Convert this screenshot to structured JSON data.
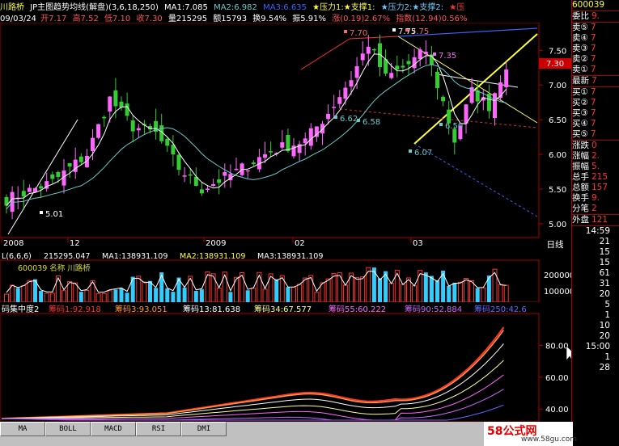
{
  "header": {
    "stock_name": "川路桥",
    "indicator_name": "JP主图趋势均线(解盘)",
    "indicator_params": "(3,6,18,250)",
    "ma1": "MA1:7.085",
    "ma2": "MA2:6.982",
    "ma3": "MA3:6.635",
    "pressure1": "★压力1:",
    "support1": "★支撑1:",
    "pressure2": "★压力2:",
    "support2": "★支撑2:",
    "pressure3": "★压"
  },
  "quote": {
    "date": "09/03/24",
    "open": "开7.17",
    "high": "高7.52",
    "low": "低7.10",
    "close": "收7.30",
    "volume": "量215295",
    "amount": "额15793",
    "turnover": "换9.54%",
    "amplitude": "振5.91%",
    "change": "涨(0.19)2.67%",
    "index": "指数(12.94)0.56%"
  },
  "main_chart": {
    "y_ticks": [
      "7.50",
      "7.00",
      "6.50",
      "6.00",
      "5.50",
      "5.00"
    ],
    "x_ticks": [
      "2008",
      "12",
      "2009",
      "02",
      "03"
    ],
    "price_tag": "7.30",
    "period_label": "日线",
    "annotations": [
      "7.70",
      "7.75",
      "7.75",
      "7.35",
      "6.62",
      "6.58",
      "6.50",
      "6.07",
      "5.01"
    ],
    "colors": {
      "up": "#ff66ff",
      "down": "#33cc33",
      "ma": "#ffffff",
      "ma_long": "#66cccc",
      "resist": "#ff3333",
      "support": "#ffff33",
      "trend": "#3366ff"
    }
  },
  "volume_chart": {
    "header_main": "L(6,6,6)",
    "header_vol": "215295.047",
    "ma1": "MA1:138931.109",
    "ma2": "MA2:138931.109",
    "ma3": "MA3:138931.109",
    "overlay_text": "600039 名称 川路桥",
    "y_ticks": [
      "200000",
      "100000"
    ]
  },
  "indicator_chart": {
    "title": "码集中度2",
    "c1": "筹码1:92.918",
    "c3": "筹码3:93.051",
    "c13": "筹码13:81.638",
    "c34": "筹码34:67.577",
    "c55": "筹码55:60.222",
    "c90": "筹码90:52.884",
    "c250": "筹码250:42.6",
    "y_ticks": [
      "80.00",
      "60.00",
      "40.00"
    ]
  },
  "tabs": [
    "MA",
    "BOLL",
    "MACD",
    "RSI",
    "DMI"
  ],
  "right_panel": {
    "code": "600039",
    "ratio_label": "委比",
    "ratio_val": "9.",
    "sell": [
      {
        "label": "卖⑤",
        "val": "7"
      },
      {
        "label": "卖④",
        "val": "7"
      },
      {
        "label": "卖③",
        "val": "7"
      },
      {
        "label": "卖②",
        "val": "7"
      },
      {
        "label": "卖①",
        "val": "7"
      }
    ],
    "latest_label": "最新",
    "latest_val": "7",
    "buy": [
      {
        "label": "买①",
        "val": "7"
      },
      {
        "label": "买②",
        "val": "7"
      },
      {
        "label": "买③",
        "val": "7"
      },
      {
        "label": "买④",
        "val": "7"
      },
      {
        "label": "买⑤",
        "val": "7"
      }
    ],
    "stats": [
      {
        "label": "涨跌",
        "val": "0"
      },
      {
        "label": "涨幅",
        "val": "2."
      },
      {
        "label": "振幅",
        "val": "5."
      },
      {
        "label": "总手",
        "val": "215"
      },
      {
        "label": "总额",
        "val": "157"
      },
      {
        "label": "换手",
        "val": "9."
      },
      {
        "label": "分笔",
        "val": "2"
      }
    ],
    "outer_label": "外盘",
    "outer_val": "121",
    "ticks": [
      {
        "time": "14:59",
        "val": ""
      },
      {
        "time": "",
        "val": "21"
      },
      {
        "time": "",
        "val": "15"
      },
      {
        "time": "",
        "val": "15"
      },
      {
        "time": "",
        "val": "61"
      },
      {
        "time": "",
        "val": "31"
      },
      {
        "time": "",
        "val": "20"
      },
      {
        "time": "",
        "val": "5"
      },
      {
        "time": "",
        "val": "1"
      },
      {
        "time": "",
        "val": "10"
      },
      {
        "time": "",
        "val": "20"
      },
      {
        "time": "15:00",
        "val": ""
      },
      {
        "time": "",
        "val": "1"
      },
      {
        "time": "",
        "val": "28"
      }
    ]
  },
  "watermark": {
    "brand": "58公式网",
    "url": "www.58gu.com"
  }
}
